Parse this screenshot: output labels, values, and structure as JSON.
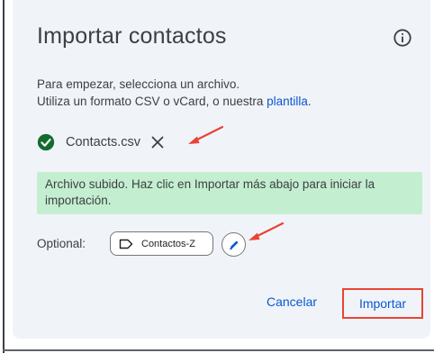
{
  "dialog": {
    "title": "Importar contactos",
    "intro_line1": "Para empezar, selecciona un archivo.",
    "intro_line2_prefix": "Utiliza un formato CSV o vCard, o nuestra ",
    "template_link": "plantilla",
    "intro_line2_suffix": ".",
    "file_name": "Contacts.csv",
    "success_message": "Archivo subido. Haz clic en Importar más abajo para iniciar la importación.",
    "optional_label": "Optional:",
    "label_chip": "Contactos-Z",
    "cancel_button": "Cancelar",
    "import_button": "Importar"
  },
  "colors": {
    "accent": "#0b57d0",
    "success_banner": "#c4eed0",
    "check_green": "#146c2e",
    "annotation_red": "#ea4335"
  },
  "icons": [
    "info-icon",
    "check-circle-icon",
    "close-icon",
    "label-icon",
    "pencil-icon",
    "annotation-arrow"
  ]
}
